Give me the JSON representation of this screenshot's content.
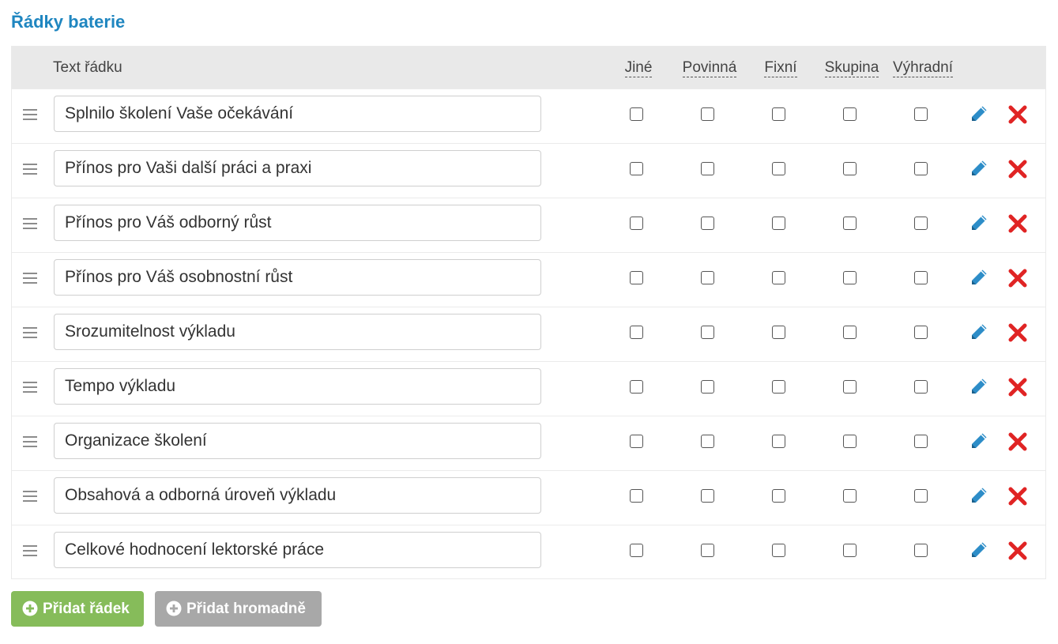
{
  "title": "Řádky baterie",
  "header": {
    "text_col": "Text řádku",
    "columns": [
      "Jiné",
      "Povinná",
      "Fixní",
      "Skupina",
      "Výhradní"
    ]
  },
  "rows": [
    {
      "text": "Splnilo školení Vaše očekávání"
    },
    {
      "text": "Přínos pro Vaši další práci a praxi"
    },
    {
      "text": "Přínos pro Váš odborný růst"
    },
    {
      "text": "Přínos pro Váš osobnostní růst"
    },
    {
      "text": "Srozumitelnost výkladu"
    },
    {
      "text": "Tempo výkladu"
    },
    {
      "text": "Organizace školení"
    },
    {
      "text": "Obsahová a odborná úroveň výkladu"
    },
    {
      "text": "Celkové hodnocení lektorské práce"
    }
  ],
  "buttons": {
    "add_row": "Přidat řádek",
    "add_bulk": "Přidat hromadně"
  },
  "icons": {
    "drag": "drag-handle-icon",
    "edit": "pencil-icon",
    "delete": "close-icon",
    "add": "plus-circle-icon"
  },
  "colors": {
    "title": "#1f86c0",
    "edit": "#2d8dc8",
    "delete": "#e02424",
    "add_button": "#86bc5a",
    "bulk_button": "#a8a8a8",
    "header_bg": "#e9e9e9"
  }
}
